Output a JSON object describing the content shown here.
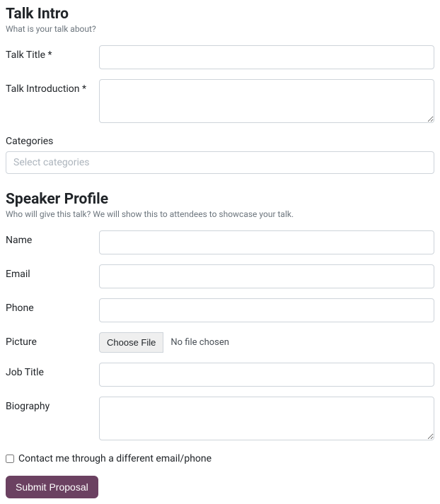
{
  "talk_intro": {
    "title": "Talk Intro",
    "subtitle": "What is your talk about?",
    "fields": {
      "talk_title": {
        "label": "Talk Title *",
        "value": ""
      },
      "talk_introduction": {
        "label": "Talk Introduction *",
        "value": ""
      }
    }
  },
  "categories": {
    "label": "Categories",
    "placeholder": "Select categories",
    "value": ""
  },
  "speaker_profile": {
    "title": "Speaker Profile",
    "subtitle": "Who will give this talk? We will show this to attendees to showcase your talk.",
    "fields": {
      "name": {
        "label": "Name",
        "value": ""
      },
      "email": {
        "label": "Email",
        "value": ""
      },
      "phone": {
        "label": "Phone",
        "value": ""
      },
      "picture": {
        "label": "Picture",
        "button_text": "Choose File",
        "status": "No file chosen"
      },
      "job_title": {
        "label": "Job Title",
        "value": ""
      },
      "biography": {
        "label": "Biography",
        "value": ""
      }
    }
  },
  "contact_alt": {
    "label": "Contact me through a different email/phone",
    "checked": false
  },
  "submit": {
    "label": "Submit Proposal"
  },
  "colors": {
    "primary": "#6b4161"
  }
}
